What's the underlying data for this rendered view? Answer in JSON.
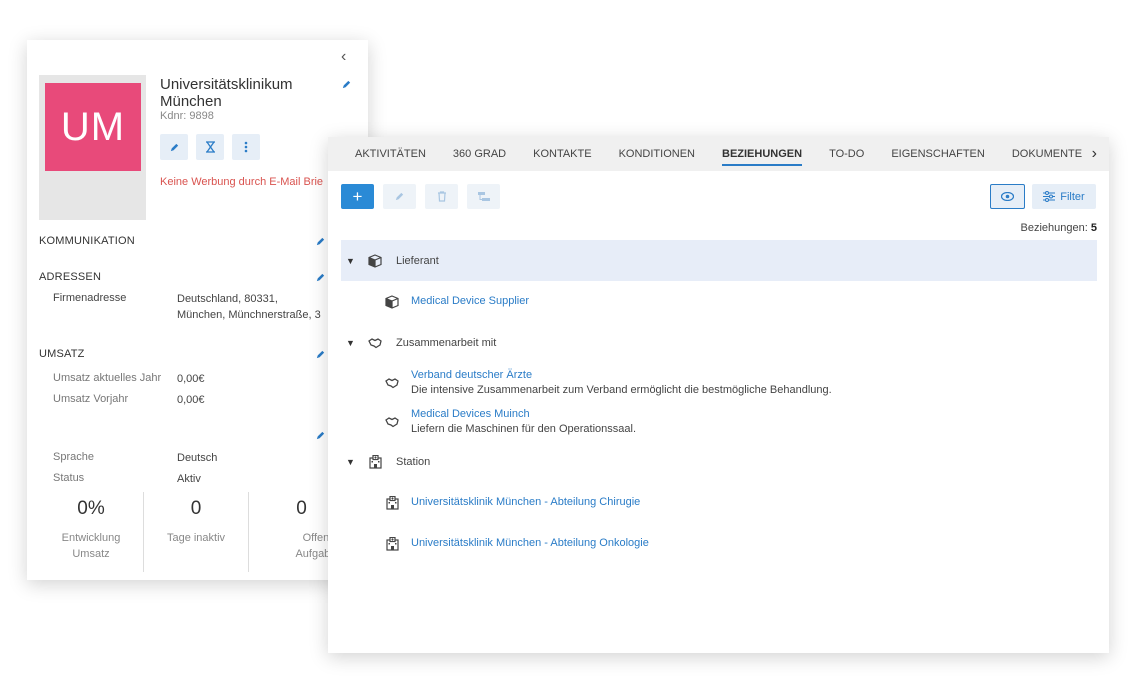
{
  "customer": {
    "initials": "UM",
    "name": "Universitätsklinikum München",
    "number": "Kdnr: 9898",
    "warning": "Keine Werbung durch E-Mail Brie",
    "avatar_color": "#e84a7a"
  },
  "sections": {
    "communication": "KOMMUNIKATION",
    "addresses": "ADRESSEN",
    "address_label": "Firmenadresse",
    "address_line1": "Deutschland, 80331,",
    "address_line2": "München, Münchnerstraße, 3",
    "revenue": "UMSATZ",
    "revenue_current_label": "Umsatz aktuelles Jahr",
    "revenue_current_value": "0,00€",
    "revenue_prev_label": "Umsatz Vorjahr",
    "revenue_prev_value": "0,00€",
    "language_label": "Sprache",
    "language_value": "Deutsch",
    "status_label": "Status",
    "status_value": "Aktiv"
  },
  "kpis": [
    {
      "value": "0%",
      "label_1": "Entwicklung",
      "label_2": "Umsatz"
    },
    {
      "value": "0",
      "label_1": "Tage inaktiv",
      "label_2": ""
    },
    {
      "value": "0",
      "label_1": "Offene",
      "label_2": "Aufgaben"
    }
  ],
  "tabs": [
    "AKTIVITÄTEN",
    "360 GRAD",
    "KONTAKTE",
    "KONDITIONEN",
    "BEZIEHUNGEN",
    "TO-DO",
    "EIGENSCHAFTEN",
    "DOKUMENTE"
  ],
  "active_tab": "BEZIEHUNGEN",
  "toolbar": {
    "add": "+",
    "filter": "Filter",
    "count_label": "Beziehungen:",
    "count_value": "5"
  },
  "groups": {
    "supplier": {
      "label": "Lieferant",
      "items": [
        {
          "title": "Medical Device Supplier"
        }
      ]
    },
    "cooperation": {
      "label": "Zusammenarbeit mit",
      "items": [
        {
          "title": "Verband deutscher Ärzte",
          "desc": "Die intensive Zusammenarbeit zum Verband ermöglicht die bestmögliche Behandlung."
        },
        {
          "title": "Medical Devices Muinch",
          "desc": "Liefern die Maschinen für den Operationssaal."
        }
      ]
    },
    "station": {
      "label": "Station",
      "items": [
        {
          "title": "Universitätsklinik München - Abteilung Chirugie"
        },
        {
          "title": "Universitätsklinik München - Abteilung Onkologie"
        }
      ]
    }
  },
  "colors": {
    "accent": "#2a7cc7",
    "warning": "#d9534f",
    "selected_row": "#e7edf8"
  }
}
